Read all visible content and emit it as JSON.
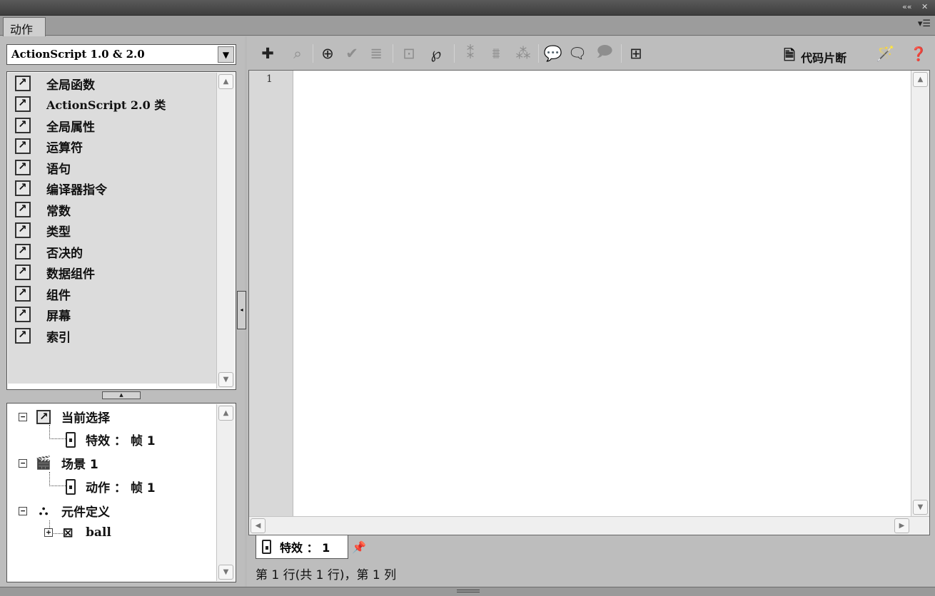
{
  "window": {
    "collapse_label": "««",
    "close_label": "✕"
  },
  "panel": {
    "tab_label": "动作",
    "menu_label": "▾☰"
  },
  "version_select": {
    "value": "ActionScript 1.0 & 2.0"
  },
  "toolbox": {
    "items": [
      {
        "label": "全局函数"
      },
      {
        "label": "ActionScript 2.0 类"
      },
      {
        "label": "全局属性"
      },
      {
        "label": "运算符"
      },
      {
        "label": "语句"
      },
      {
        "label": "编译器指令"
      },
      {
        "label": "常数"
      },
      {
        "label": "类型"
      },
      {
        "label": "否决的"
      },
      {
        "label": "数据组件"
      },
      {
        "label": "组件"
      },
      {
        "label": "屏幕"
      },
      {
        "label": "索引"
      }
    ]
  },
  "script_nav": {
    "current_selection": {
      "label": "当前选择",
      "child": "特效 ： 帧 1"
    },
    "scene": {
      "label": "场景 1",
      "child": "动作 ： 帧 1"
    },
    "symbols": {
      "label": "元件定义",
      "child": "ball"
    }
  },
  "toolbar": {
    "icons": [
      "add-icon",
      "find-icon",
      "target-icon",
      "check-syntax-icon",
      "auto-format-icon",
      "code-hint-icon",
      "debug-options-icon",
      "collapse-between-braces-icon",
      "collapse-selection-icon",
      "expand-all-icon",
      "apply-block-comment-icon",
      "apply-line-comment-icon",
      "remove-comment-icon",
      "show-hide-toolbox-icon"
    ],
    "code_snippets_label": "代码片断",
    "script_assist_icon": "wand-icon",
    "help_icon": "help-icon"
  },
  "editor": {
    "line_numbers": [
      "1"
    ],
    "content": ""
  },
  "script_tab": {
    "label": "特效 ： 1"
  },
  "status_bar": {
    "text": "第 1 行(共 1 行)，第 1 列"
  }
}
